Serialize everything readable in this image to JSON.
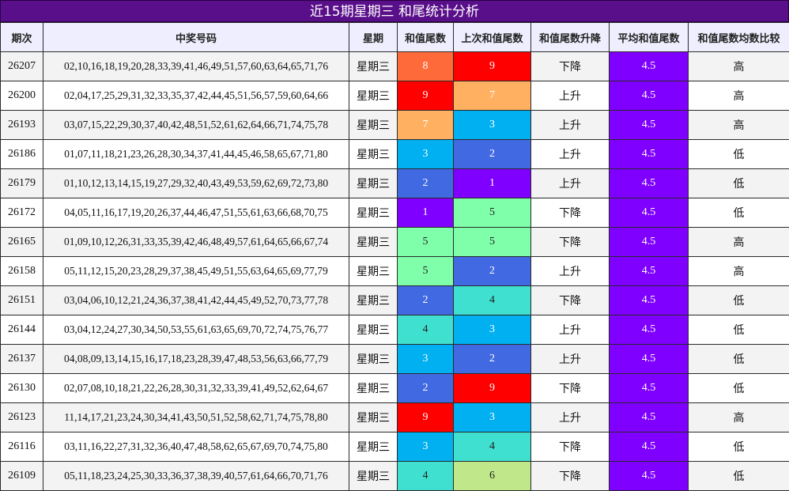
{
  "title": "近15期星期三 和尾统计分析",
  "headers": [
    "期次",
    "中奖号码",
    "星期",
    "和值尾数",
    "上次和值尾数",
    "和值尾数升降",
    "平均和值尾数",
    "和值尾数均数比较"
  ],
  "colors": {
    "tail_0": "#f0f0f0",
    "tail_1": "#7f00ff",
    "tail_2": "#4169e1",
    "tail_3": "#00b0f0",
    "tail_4": "#40e0d0",
    "tail_5": "#7fffaa",
    "tail_6": "#c0e88a",
    "tail_7": "#ffb060",
    "tail_8": "#ff6a3a",
    "tail_9": "#ff0000",
    "avg": "#7f00ff",
    "title_bg": "#5a0f8a"
  },
  "rows": [
    {
      "period": "26207",
      "numbers": "02,10,16,18,19,20,28,33,39,41,46,49,51,57,60,63,64,65,71,76",
      "weekday": "星期三",
      "tail": "8",
      "prev_tail": "9",
      "trend": "下降",
      "avg": "4.5",
      "compare": "高"
    },
    {
      "period": "26200",
      "numbers": "02,04,17,25,29,31,32,33,35,37,42,44,45,51,56,57,59,60,64,66",
      "weekday": "星期三",
      "tail": "9",
      "prev_tail": "7",
      "trend": "上升",
      "avg": "4.5",
      "compare": "高"
    },
    {
      "period": "26193",
      "numbers": "03,07,15,22,29,30,37,40,42,48,51,52,61,62,64,66,71,74,75,78",
      "weekday": "星期三",
      "tail": "7",
      "prev_tail": "3",
      "trend": "上升",
      "avg": "4.5",
      "compare": "高"
    },
    {
      "period": "26186",
      "numbers": "01,07,11,18,21,23,26,28,30,34,37,41,44,45,46,58,65,67,71,80",
      "weekday": "星期三",
      "tail": "3",
      "prev_tail": "2",
      "trend": "上升",
      "avg": "4.5",
      "compare": "低"
    },
    {
      "period": "26179",
      "numbers": "01,10,12,13,14,15,19,27,29,32,40,43,49,53,59,62,69,72,73,80",
      "weekday": "星期三",
      "tail": "2",
      "prev_tail": "1",
      "trend": "上升",
      "avg": "4.5",
      "compare": "低"
    },
    {
      "period": "26172",
      "numbers": "04,05,11,16,17,19,20,26,37,44,46,47,51,55,61,63,66,68,70,75",
      "weekday": "星期三",
      "tail": "1",
      "prev_tail": "5",
      "trend": "下降",
      "avg": "4.5",
      "compare": "低"
    },
    {
      "period": "26165",
      "numbers": "01,09,10,12,26,31,33,35,39,42,46,48,49,57,61,64,65,66,67,74",
      "weekday": "星期三",
      "tail": "5",
      "prev_tail": "5",
      "trend": "下降",
      "avg": "4.5",
      "compare": "高"
    },
    {
      "period": "26158",
      "numbers": "05,11,12,15,20,23,28,29,37,38,45,49,51,55,63,64,65,69,77,79",
      "weekday": "星期三",
      "tail": "5",
      "prev_tail": "2",
      "trend": "上升",
      "avg": "4.5",
      "compare": "高"
    },
    {
      "period": "26151",
      "numbers": "03,04,06,10,12,21,24,36,37,38,41,42,44,45,49,52,70,73,77,78",
      "weekday": "星期三",
      "tail": "2",
      "prev_tail": "4",
      "trend": "下降",
      "avg": "4.5",
      "compare": "低"
    },
    {
      "period": "26144",
      "numbers": "03,04,12,24,27,30,34,50,53,55,61,63,65,69,70,72,74,75,76,77",
      "weekday": "星期三",
      "tail": "4",
      "prev_tail": "3",
      "trend": "上升",
      "avg": "4.5",
      "compare": "低"
    },
    {
      "period": "26137",
      "numbers": "04,08,09,13,14,15,16,17,18,23,28,39,47,48,53,56,63,66,77,79",
      "weekday": "星期三",
      "tail": "3",
      "prev_tail": "2",
      "trend": "上升",
      "avg": "4.5",
      "compare": "低"
    },
    {
      "period": "26130",
      "numbers": "02,07,08,10,18,21,22,26,28,30,31,32,33,39,41,49,52,62,64,67",
      "weekday": "星期三",
      "tail": "2",
      "prev_tail": "9",
      "trend": "下降",
      "avg": "4.5",
      "compare": "低"
    },
    {
      "period": "26123",
      "numbers": "11,14,17,21,23,24,30,34,41,43,50,51,52,58,62,71,74,75,78,80",
      "weekday": "星期三",
      "tail": "9",
      "prev_tail": "3",
      "trend": "上升",
      "avg": "4.5",
      "compare": "高"
    },
    {
      "period": "26116",
      "numbers": "03,11,16,22,27,31,32,36,40,47,48,58,62,65,67,69,70,74,75,80",
      "weekday": "星期三",
      "tail": "3",
      "prev_tail": "4",
      "trend": "下降",
      "avg": "4.5",
      "compare": "低"
    },
    {
      "period": "26109",
      "numbers": "05,11,18,23,24,25,30,33,36,37,38,39,40,57,61,64,66,70,71,76",
      "weekday": "星期三",
      "tail": "4",
      "prev_tail": "6",
      "trend": "下降",
      "avg": "4.5",
      "compare": "低"
    }
  ]
}
